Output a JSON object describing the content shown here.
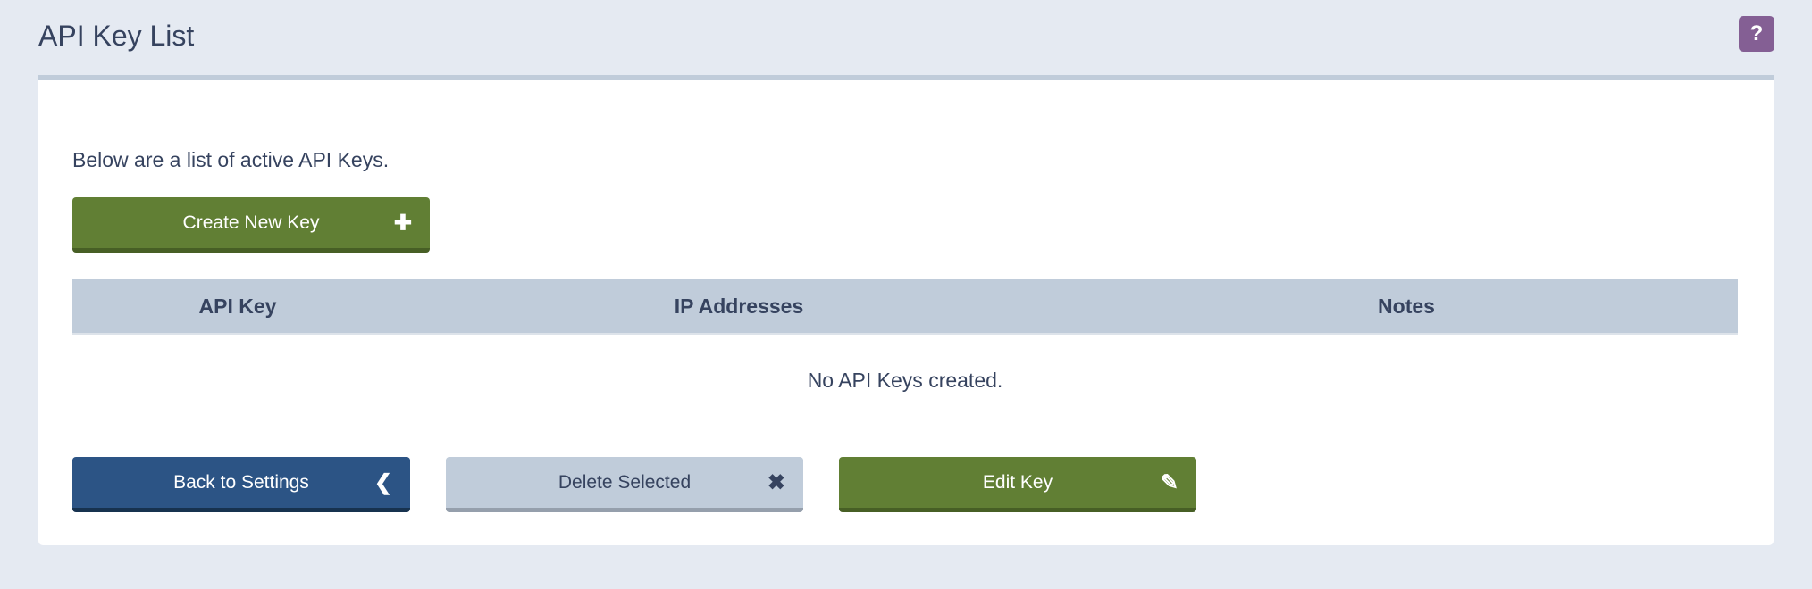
{
  "header": {
    "title": "API Key List",
    "help_label": "?"
  },
  "panel": {
    "intro": "Below are a list of active API Keys.",
    "create_button": {
      "label": "Create New Key",
      "icon": "plus-icon"
    },
    "table": {
      "columns": [
        "API Key",
        "IP Addresses",
        "Notes"
      ],
      "empty_message": "No API Keys created."
    },
    "buttons": {
      "back": {
        "label": "Back to Settings",
        "icon": "chevron-left-icon"
      },
      "delete": {
        "label": "Delete Selected",
        "icon": "close-icon"
      },
      "edit": {
        "label": "Edit Key",
        "icon": "pencil-icon"
      }
    }
  },
  "colors": {
    "background": "#e5eaf2",
    "green": "#617f34",
    "blue": "#2c5485",
    "grey": "#c0ccda",
    "help": "#845f94",
    "text": "#36435f"
  }
}
